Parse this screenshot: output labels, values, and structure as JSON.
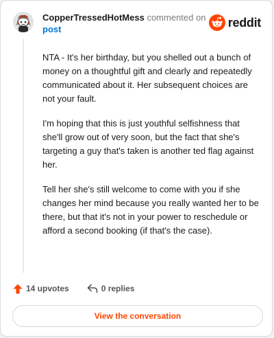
{
  "header": {
    "username": "CopperTressedHotMess",
    "action_text": "commented on",
    "post_link": "post",
    "brand": "reddit",
    "avatar_icon": "snoo-avatar-icon",
    "brand_icon": "reddit-logo-icon"
  },
  "comment": {
    "paragraphs": [
      "NTA - It's her birthday, but you shelled out a bunch of money on a thoughtful gift and clearly and repeatedly communicated about it. Her subsequent choices are not your fault.",
      "I'm hoping that this is just youthful selfishness that she'll grow out of very soon, but the fact that she's targeting a guy that's taken is another ted flag against her.",
      "Tell her she's still welcome to come with you if she changes her mind because you really wanted her to be there, but that it's not in your power to reschedule or afford a second booking (if that's the case)."
    ]
  },
  "footer": {
    "upvotes": "14 upvotes",
    "replies": "0 replies",
    "cta": "View the conversation",
    "upvote_icon": "upvote-arrow-icon",
    "reply_icon": "reply-arrow-icon"
  },
  "colors": {
    "brand_orange": "#ff4500",
    "link_blue": "#0079d3",
    "text": "#1a1a1b",
    "muted": "#7c7c7c"
  }
}
